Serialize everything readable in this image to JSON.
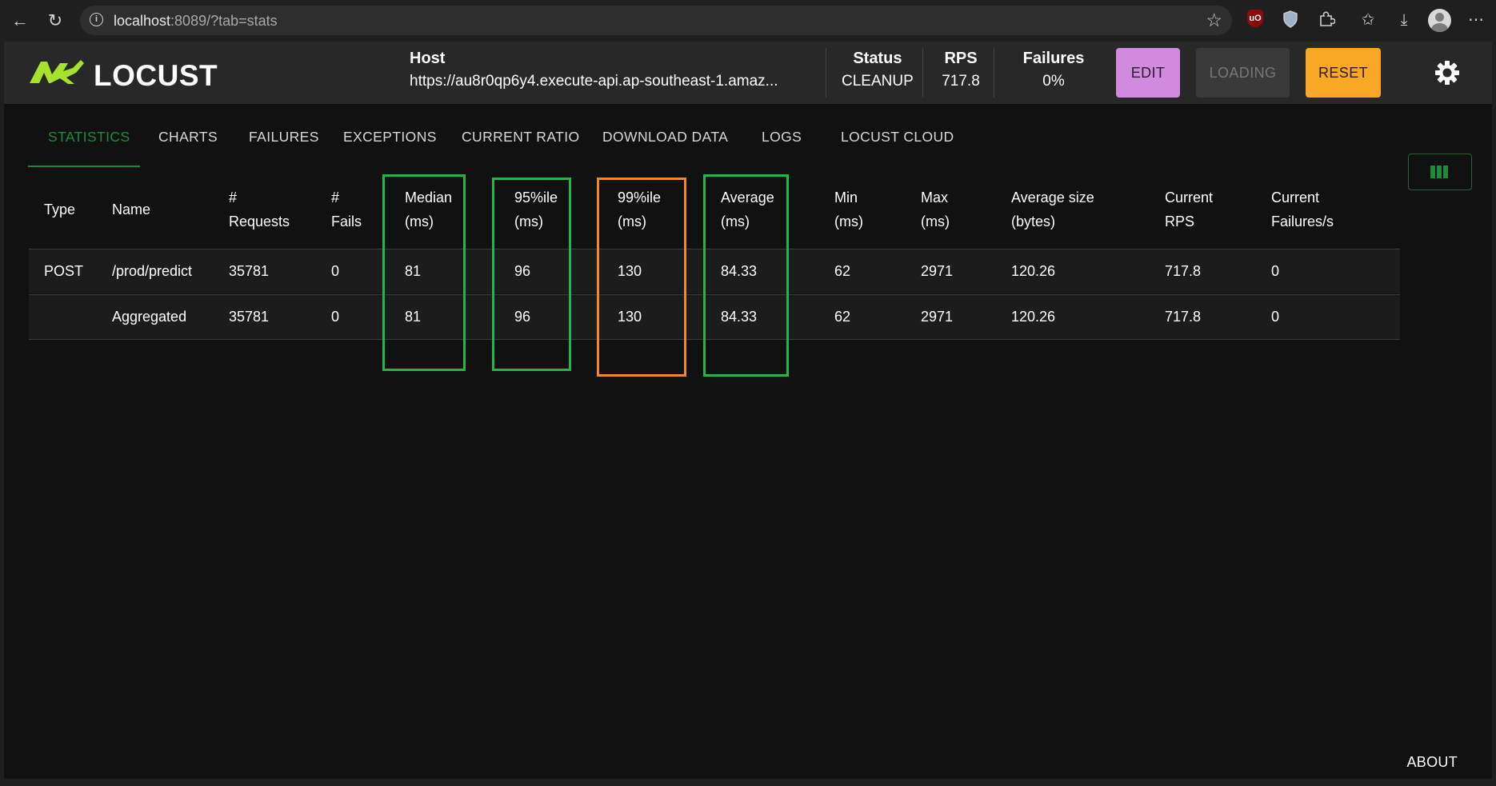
{
  "browser": {
    "url_host": "localhost",
    "url_rest": ":8089/?tab=stats",
    "icons": [
      "back-icon",
      "reload-icon",
      "info-icon",
      "star-icon",
      "ublock-icon",
      "shield-icon",
      "extensions-icon",
      "favorites-icon",
      "download-icon",
      "profile-icon",
      "more-icon"
    ]
  },
  "header": {
    "logo_text": "LOCUST",
    "host_label": "Host",
    "host_value": "https://au8r0qp6y4.execute-api.ap-southeast-1.amaz...",
    "status_label": "Status",
    "status_value": "CLEANUP",
    "rps_label": "RPS",
    "rps_value": "717.8",
    "failures_label": "Failures",
    "failures_value": "0%",
    "edit_label": "EDIT",
    "loading_label": "LOADING",
    "reset_label": "RESET",
    "colors": {
      "edit": "#d08ade",
      "reset": "#f9a825",
      "accent": "#1e8a3c"
    }
  },
  "tabs": [
    {
      "label": "STATISTICS",
      "active": true
    },
    {
      "label": "CHARTS"
    },
    {
      "label": "FAILURES"
    },
    {
      "label": "EXCEPTIONS"
    },
    {
      "label": "CURRENT RATIO"
    },
    {
      "label": "DOWNLOAD DATA"
    },
    {
      "label": "LOGS"
    },
    {
      "label": "LOCUST CLOUD"
    }
  ],
  "table": {
    "columns": [
      {
        "line1": "Type",
        "line2": ""
      },
      {
        "line1": "Name",
        "line2": ""
      },
      {
        "line1": "#",
        "line2": "Requests"
      },
      {
        "line1": "#",
        "line2": "Fails"
      },
      {
        "line1": "Median",
        "line2": "(ms)"
      },
      {
        "line1": "95%ile",
        "line2": "(ms)"
      },
      {
        "line1": "99%ile",
        "line2": "(ms)"
      },
      {
        "line1": "Average",
        "line2": "(ms)"
      },
      {
        "line1": "Min",
        "line2": "(ms)"
      },
      {
        "line1": "Max",
        "line2": "(ms)"
      },
      {
        "line1": "Average size",
        "line2": "(bytes)"
      },
      {
        "line1": "Current",
        "line2": "RPS"
      },
      {
        "line1": "Current",
        "line2": "Failures/s"
      }
    ],
    "rows": [
      [
        "POST",
        "/prod/predict",
        "35781",
        "0",
        "81",
        "96",
        "130",
        "84.33",
        "62",
        "2971",
        "120.26",
        "717.8",
        "0"
      ],
      [
        "",
        "Aggregated",
        "35781",
        "0",
        "81",
        "96",
        "130",
        "84.33",
        "62",
        "2971",
        "120.26",
        "717.8",
        "0"
      ]
    ],
    "highlight_colors": {
      "median": "#28b34a",
      "p95": "#28b34a",
      "p99": "#f08a28",
      "average": "#28b34a"
    }
  },
  "footer": {
    "about_label": "ABOUT"
  }
}
